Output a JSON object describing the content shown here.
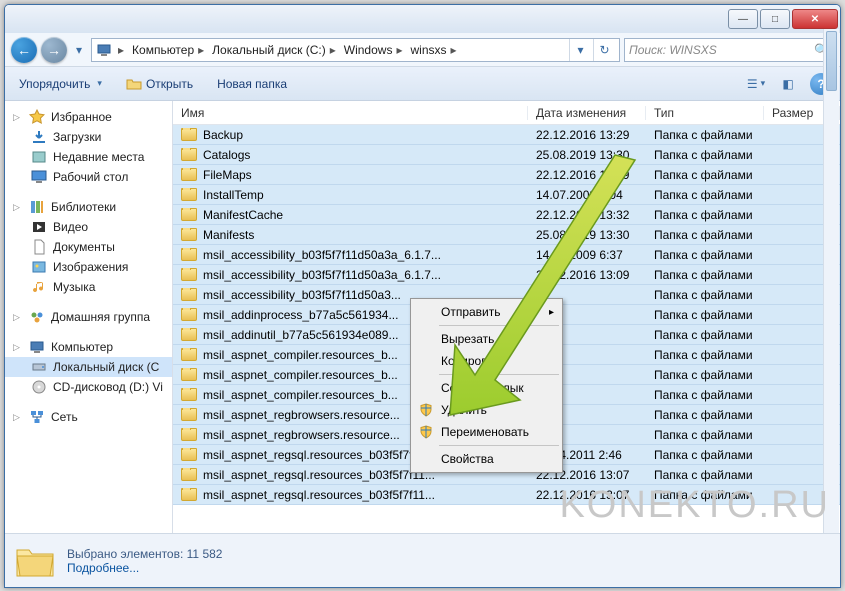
{
  "breadcrumbs": [
    "Компьютер",
    "Локальный диск (C:)",
    "Windows",
    "winsxs"
  ],
  "search_placeholder": "Поиск: WINSXS",
  "toolbar": {
    "organize": "Упорядочить",
    "open": "Открыть",
    "new_folder": "Новая папка"
  },
  "columns": {
    "name": "Имя",
    "date": "Дата изменения",
    "type": "Тип",
    "size": "Размер"
  },
  "sidebar": {
    "favorites": {
      "label": "Избранное",
      "items": [
        "Загрузки",
        "Недавние места",
        "Рабочий стол"
      ]
    },
    "libraries": {
      "label": "Библиотеки",
      "items": [
        "Видео",
        "Документы",
        "Изображения",
        "Музыка"
      ]
    },
    "homegroup": "Домашняя группа",
    "computer": {
      "label": "Компьютер",
      "items": [
        "Локальный диск (C",
        "CD-дисковод (D:) Vi"
      ]
    },
    "network": "Сеть"
  },
  "files": [
    {
      "name": "Backup",
      "date": "22.12.2016 13:29",
      "type": "Папка с файлами"
    },
    {
      "name": "Catalogs",
      "date": "25.08.2019 13:30",
      "type": "Папка с файлами"
    },
    {
      "name": "FileMaps",
      "date": "22.12.2016 13:29",
      "type": "Папка с файлами"
    },
    {
      "name": "InstallTemp",
      "date": "14.07.2009 6:04",
      "type": "Папка с файлами"
    },
    {
      "name": "ManifestCache",
      "date": "22.12.2016 13:32",
      "type": "Папка с файлами"
    },
    {
      "name": "Manifests",
      "date": "25.08.2019 13:30",
      "type": "Папка с файлами"
    },
    {
      "name": "msil_accessibility_b03f5f7f11d50a3a_6.1.7...",
      "date": "14.07.2009 6:37",
      "type": "Папка с файлами"
    },
    {
      "name": "msil_accessibility_b03f5f7f11d50a3a_6.1.7...",
      "date": "22.12.2016 13:09",
      "type": "Папка с файлами"
    },
    {
      "name": "msil_accessibility_b03f5f7f11d50a3...",
      "date": "",
      "type": "Папка с файлами"
    },
    {
      "name": "msil_addinprocess_b77a5c561934...",
      "date": "",
      "type": "Папка с файлами"
    },
    {
      "name": "msil_addinutil_b77a5c561934e089...",
      "date": "",
      "type": "Папка с файлами"
    },
    {
      "name": "msil_aspnet_compiler.resources_b...",
      "date": "",
      "type": "Папка с файлами"
    },
    {
      "name": "msil_aspnet_compiler.resources_b...",
      "date": "",
      "type": "Папка с файлами"
    },
    {
      "name": "msil_aspnet_compiler.resources_b...",
      "date": "",
      "type": "Папка с файлами"
    },
    {
      "name": "msil_aspnet_regbrowsers.resource...",
      "date": "",
      "type": "Папка с файлами"
    },
    {
      "name": "msil_aspnet_regbrowsers.resource...",
      "date": "",
      "type": "Папка с файлами"
    },
    {
      "name": "msil_aspnet_regsql.resources_b03f5f7f11...",
      "date": "12.04.2011 2:46",
      "type": "Папка с файлами"
    },
    {
      "name": "msil_aspnet_regsql.resources_b03f5f7f11...",
      "date": "22.12.2016 13:07",
      "type": "Папка с файлами"
    },
    {
      "name": "msil_aspnet_regsql.resources_b03f5f7f11...",
      "date": "22.12.2016 13:07",
      "type": "Папка с файлами"
    }
  ],
  "contextmenu": {
    "send_to": "Отправить",
    "cut": "Вырезать",
    "copy": "Копировать",
    "create_shortcut": "Создать ярлык",
    "delete": "Удалить",
    "rename": "Переименовать",
    "properties": "Свойства"
  },
  "status": {
    "selected": "Выбрано элементов: 11 582",
    "details": "Подробнее..."
  },
  "watermark": "KONEKTO.RU"
}
